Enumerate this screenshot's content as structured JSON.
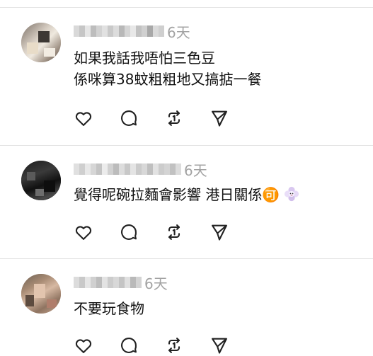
{
  "comments": [
    {
      "username": "",
      "time": "6天",
      "lines": [
        "如果我話我唔怕三色豆",
        "係咪算38蚊粗粗地又搞掂一餐"
      ],
      "emoji": ""
    },
    {
      "username": "",
      "time": "6天",
      "lines": [
        "覺得呢碗拉麵會影響 港日關係🉑"
      ],
      "emoji": "flower-icon"
    },
    {
      "username": "",
      "time": "6天",
      "lines": [
        "不要玩食物"
      ],
      "emoji": ""
    }
  ],
  "actions": [
    "like-icon",
    "reply-icon",
    "repost-icon",
    "share-icon"
  ]
}
